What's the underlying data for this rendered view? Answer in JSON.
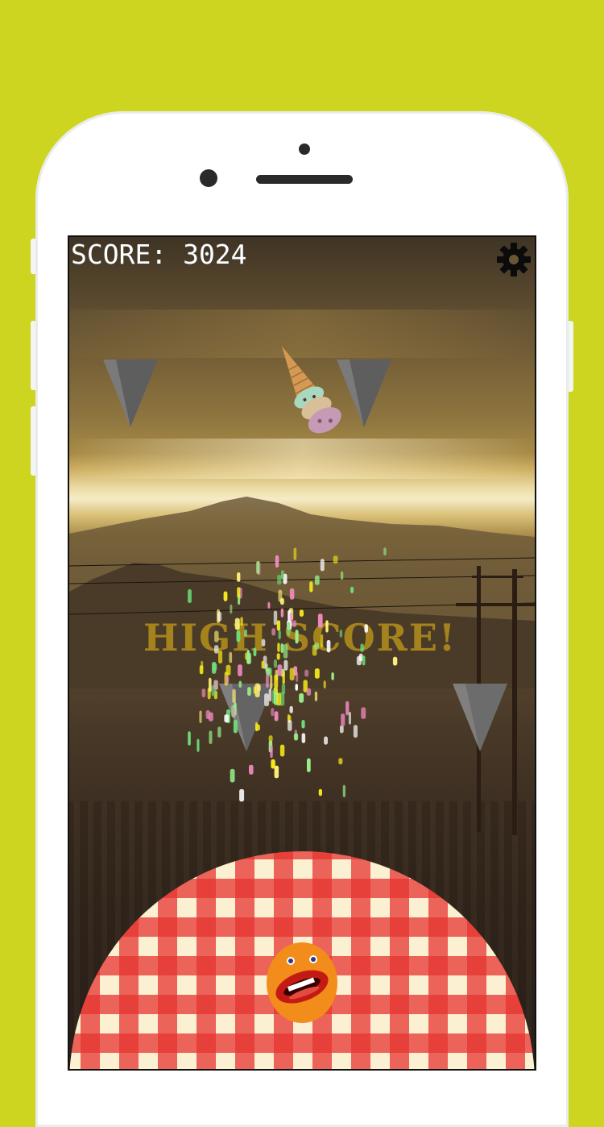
{
  "hud": {
    "score_text": "SCORE: 3024",
    "settings_icon": "gear-icon"
  },
  "banner": {
    "high_score_text": "HIGH SCORE!"
  },
  "colors": {
    "background": "#cdd520",
    "banner_text": "#b5901a",
    "blanket_red": "#e63430",
    "blanket_cream": "#fbf0d2",
    "player_orange": "#f28c1a"
  },
  "icons": {
    "falling_item": "ice-cream-cone-icon",
    "hazard": "triangle-spike-icon",
    "player": "orange-mouth-character-icon"
  }
}
